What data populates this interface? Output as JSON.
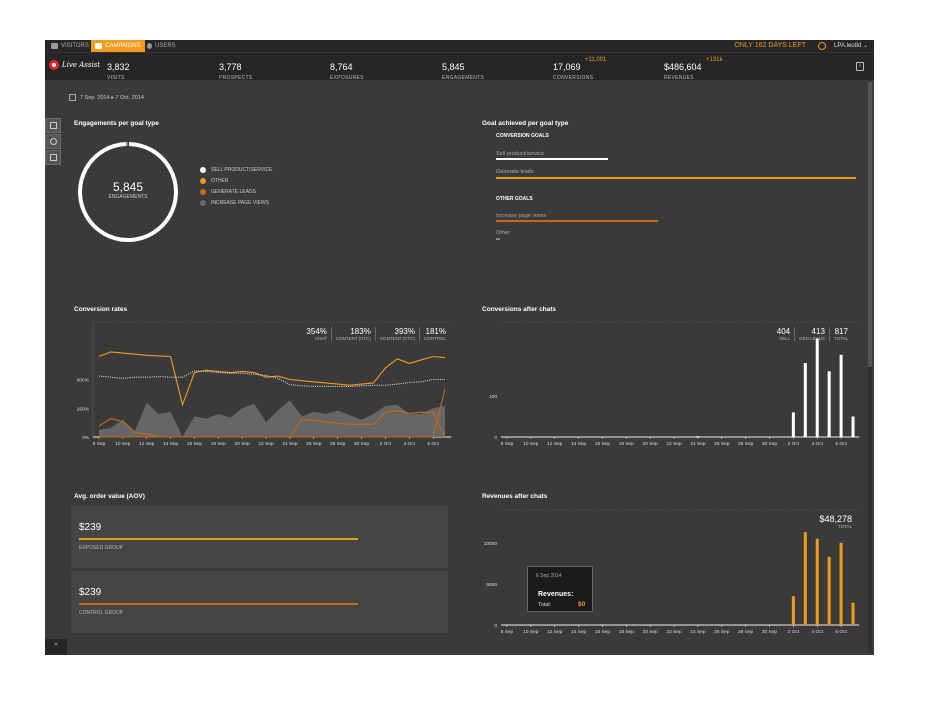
{
  "colors": {
    "accent": "#f09b1c",
    "dark_orange": "#c96a10",
    "gray_area": "#6b6b6c",
    "white": "#ffffff"
  },
  "nav": {
    "tabs": [
      {
        "label": "VISITORS",
        "icon": "chat-icon"
      },
      {
        "label": "CAMPAIGNS",
        "icon": "tag-icon"
      },
      {
        "label": "USERS",
        "icon": "user-icon"
      }
    ],
    "trial": "ONLY 162 DAYS LEFT",
    "account": "LPA.leo8d"
  },
  "logo": {
    "text": "Live Assist"
  },
  "stats": [
    {
      "value": "3,832",
      "label": "VISITS",
      "delta": ""
    },
    {
      "value": "3,778",
      "label": "PROSPECTS",
      "delta": ""
    },
    {
      "value": "8,764",
      "label": "EXPOSURES",
      "delta": ""
    },
    {
      "value": "5,845",
      "label": "ENGAGEMENTS",
      "delta": ""
    },
    {
      "value": "17,069",
      "label": "CONVERSIONS",
      "delta": "+11,001"
    },
    {
      "value": "$486,604",
      "label": "REVENUES",
      "delta": "+131k"
    }
  ],
  "date_range": "7 Sep. 2014 ▸ 7 Oct. 2014",
  "engagements": {
    "title": "Engagements per goal type",
    "total": "5,845",
    "total_label": "ENGAGEMENTS",
    "legend": [
      {
        "label": "SELL PRODUCT/SERVICE",
        "color": "#ffffff"
      },
      {
        "label": "OTHER",
        "color": "#f09b1c"
      },
      {
        "label": "GENERATE LEADS",
        "color": "#c96a10"
      },
      {
        "label": "INCREASE PAGE VIEWS",
        "color": "#6b6b6c"
      }
    ]
  },
  "goals": {
    "title": "Goal achieved per goal type",
    "conversion_head": "CONVERSION GOALS",
    "other_head": "OTHER GOALS",
    "items": [
      {
        "label": "Sell product/service",
        "fraction": 0.31,
        "color": "#ffffff"
      },
      {
        "label": "Generate leads",
        "fraction": 1.0,
        "color": "#f09b1c"
      },
      {
        "label": "Increase page views",
        "fraction": 0.45,
        "color": "#c96a10"
      },
      {
        "label": "Other",
        "fraction": 0.01,
        "color": "#888888"
      }
    ]
  },
  "conversion_rates": {
    "title": "Conversion rates",
    "kpis": [
      {
        "value": "354%",
        "label": "CHAT"
      },
      {
        "value": "183%",
        "label": "CONTENT (VTC)"
      },
      {
        "value": "393%",
        "label": "CONTENT (CTC)"
      },
      {
        "value": "181%",
        "label": "CONTROL"
      }
    ]
  },
  "conversions_after_chats": {
    "title": "Conversions after chats",
    "kpis": [
      {
        "value": "404",
        "label": "SELL"
      },
      {
        "value": "413",
        "label": "GEN LEADS"
      },
      {
        "value": "817",
        "label": "TOTAL"
      }
    ]
  },
  "aov": {
    "title": "Avg. order value (AOV)",
    "cards": [
      {
        "value": "$239",
        "label": "EXPOSED GROUP",
        "fraction": 0.74,
        "color": "#f09b1c"
      },
      {
        "value": "$239",
        "label": "CONTROL GROUP",
        "fraction": 0.74,
        "color": "#c96a10"
      }
    ]
  },
  "revenues_after_chats": {
    "title": "Revenues after chats",
    "total": "$48,278",
    "total_label": "TOTAL"
  },
  "tooltip": {
    "date": "6 Sep 2014",
    "title": "Revenues:",
    "label": "Total:",
    "value": "$0"
  },
  "chart_data": [
    {
      "type": "pie",
      "categories": [
        "SELL PRODUCT/SERVICE",
        "OTHER",
        "GENERATE LEADS",
        "INCREASE PAGE VIEWS"
      ],
      "values": [
        99.5,
        0.5,
        0,
        0
      ]
    },
    {
      "type": "line",
      "title": "Conversion rates",
      "xlabel": "",
      "ylabel": "",
      "x": [
        "8 Sep",
        "9 Sep",
        "10 Sep",
        "11 Sep",
        "12 Sep",
        "13 Sep",
        "14 Sep",
        "15 Sep",
        "16 Sep",
        "17 Sep",
        "18 Sep",
        "19 Sep",
        "20 Sep",
        "21 Sep",
        "22 Sep",
        "23 Sep",
        "24 Sep",
        "25 Sep",
        "26 Sep",
        "27 Sep",
        "28 Sep",
        "29 Sep",
        "30 Sep",
        "1 Oct",
        "2 Oct",
        "3 Oct",
        "4 Oct",
        "5 Oct",
        "6 Oct",
        "7 Oct"
      ],
      "tick_labels": [
        "8 Sep",
        "10 Sep",
        "12 Sep",
        "14 Sep",
        "16 Sep",
        "18 Sep",
        "20 Sep",
        "22 Sep",
        "24 Sep",
        "26 Sep",
        "28 Sep",
        "30 Sep",
        "2 Oct",
        "4 Oct",
        "6 Oct"
      ],
      "y_ticks": [
        "0%",
        "250%",
        "500%"
      ],
      "ylim": [
        0,
        1000
      ],
      "series": [
        {
          "color": "#f09b1c",
          "style": "solid",
          "values": [
            700,
            740,
            730,
            720,
            710,
            705,
            700,
            280,
            560,
            580,
            570,
            560,
            570,
            560,
            520,
            530,
            500,
            490,
            480,
            470,
            460,
            450,
            460,
            470,
            600,
            680,
            640,
            670,
            700,
            690
          ]
        },
        {
          "color": "#dddddd",
          "style": "dotted",
          "values": [
            530,
            520,
            510,
            520,
            520,
            525,
            520,
            520,
            575,
            570,
            560,
            555,
            555,
            545,
            535,
            510,
            455,
            445,
            440,
            440,
            440,
            440,
            445,
            450,
            450,
            460,
            475,
            480,
            500,
            500
          ]
        },
        {
          "color": "#c96a10",
          "style": "solid",
          "values": [
            95,
            160,
            135,
            40,
            25,
            0,
            0,
            0,
            0,
            0,
            0,
            0,
            0,
            0,
            0,
            0,
            0,
            0,
            0,
            0,
            0,
            0,
            0,
            0,
            0,
            0,
            0,
            0,
            0,
            420
          ]
        },
        {
          "color": "#c96a10",
          "style": "solid",
          "values": [
            0,
            0,
            0,
            0,
            0,
            0,
            0,
            0,
            0,
            0,
            0,
            0,
            0,
            0,
            0,
            0,
            0,
            155,
            145,
            130,
            120,
            110,
            110,
            110,
            215,
            230,
            205,
            215,
            215,
            0
          ]
        },
        {
          "color": "#6b6b6c",
          "style": "area",
          "values": [
            60,
            80,
            150,
            50,
            300,
            200,
            220,
            0,
            180,
            160,
            200,
            170,
            250,
            290,
            130,
            230,
            320,
            180,
            220,
            200,
            230,
            190,
            150,
            200,
            270,
            280,
            200,
            200,
            250,
            270
          ]
        }
      ]
    },
    {
      "type": "bar",
      "title": "Conversions after chats",
      "x": [
        "8 Sep",
        "9 Sep",
        "10 Sep",
        "11 Sep",
        "12 Sep",
        "13 Sep",
        "14 Sep",
        "15 Sep",
        "16 Sep",
        "17 Sep",
        "18 Sep",
        "19 Sep",
        "20 Sep",
        "21 Sep",
        "22 Sep",
        "23 Sep",
        "24 Sep",
        "25 Sep",
        "26 Sep",
        "27 Sep",
        "28 Sep",
        "29 Sep",
        "30 Sep",
        "1 Oct",
        "2 Oct",
        "3 Oct",
        "4 Oct",
        "5 Oct",
        "6 Oct",
        "7 Oct"
      ],
      "tick_labels": [
        "8 Sep",
        "10 Sep",
        "12 Sep",
        "14 Sep",
        "16 Sep",
        "18 Sep",
        "20 Sep",
        "22 Sep",
        "24 Sep",
        "26 Sep",
        "28 Sep",
        "30 Sep",
        "2 Oct",
        "4 Oct",
        "6 Oct"
      ],
      "y_ticks": [
        "0",
        "100"
      ],
      "ylim": [
        0,
        280
      ],
      "values": [
        0,
        0,
        0,
        0,
        0,
        0,
        0,
        0,
        0,
        0,
        0,
        0,
        0,
        0,
        0,
        0,
        2,
        0,
        0,
        0,
        0,
        0,
        0,
        0,
        60,
        180,
        240,
        160,
        200,
        50
      ],
      "color": "#ffffff"
    },
    {
      "type": "bar",
      "title": "Revenues after chats",
      "x": [
        "8 Sep",
        "9 Sep",
        "10 Sep",
        "11 Sep",
        "12 Sep",
        "13 Sep",
        "14 Sep",
        "15 Sep",
        "16 Sep",
        "17 Sep",
        "18 Sep",
        "19 Sep",
        "20 Sep",
        "21 Sep",
        "22 Sep",
        "23 Sep",
        "24 Sep",
        "25 Sep",
        "26 Sep",
        "27 Sep",
        "28 Sep",
        "29 Sep",
        "30 Sep",
        "1 Oct",
        "2 Oct",
        "3 Oct",
        "4 Oct",
        "5 Oct",
        "6 Oct",
        "7 Oct"
      ],
      "tick_labels": [
        "8 Sep",
        "10 Sep",
        "12 Sep",
        "14 Sep",
        "16 Sep",
        "18 Sep",
        "20 Sep",
        "22 Sep",
        "24 Sep",
        "26 Sep",
        "28 Sep",
        "30 Sep",
        "2 Oct",
        "4 Oct",
        "6 Oct"
      ],
      "y_ticks": [
        "0",
        "5000",
        "10000"
      ],
      "ylim": [
        0,
        14000
      ],
      "values": [
        0,
        0,
        0,
        0,
        0,
        0,
        0,
        0,
        0,
        0,
        0,
        0,
        0,
        0,
        0,
        0,
        0,
        0,
        0,
        0,
        0,
        0,
        0,
        0,
        3500,
        11300,
        10500,
        8300,
        10000,
        2700
      ],
      "color": "#f09b1c"
    }
  ]
}
